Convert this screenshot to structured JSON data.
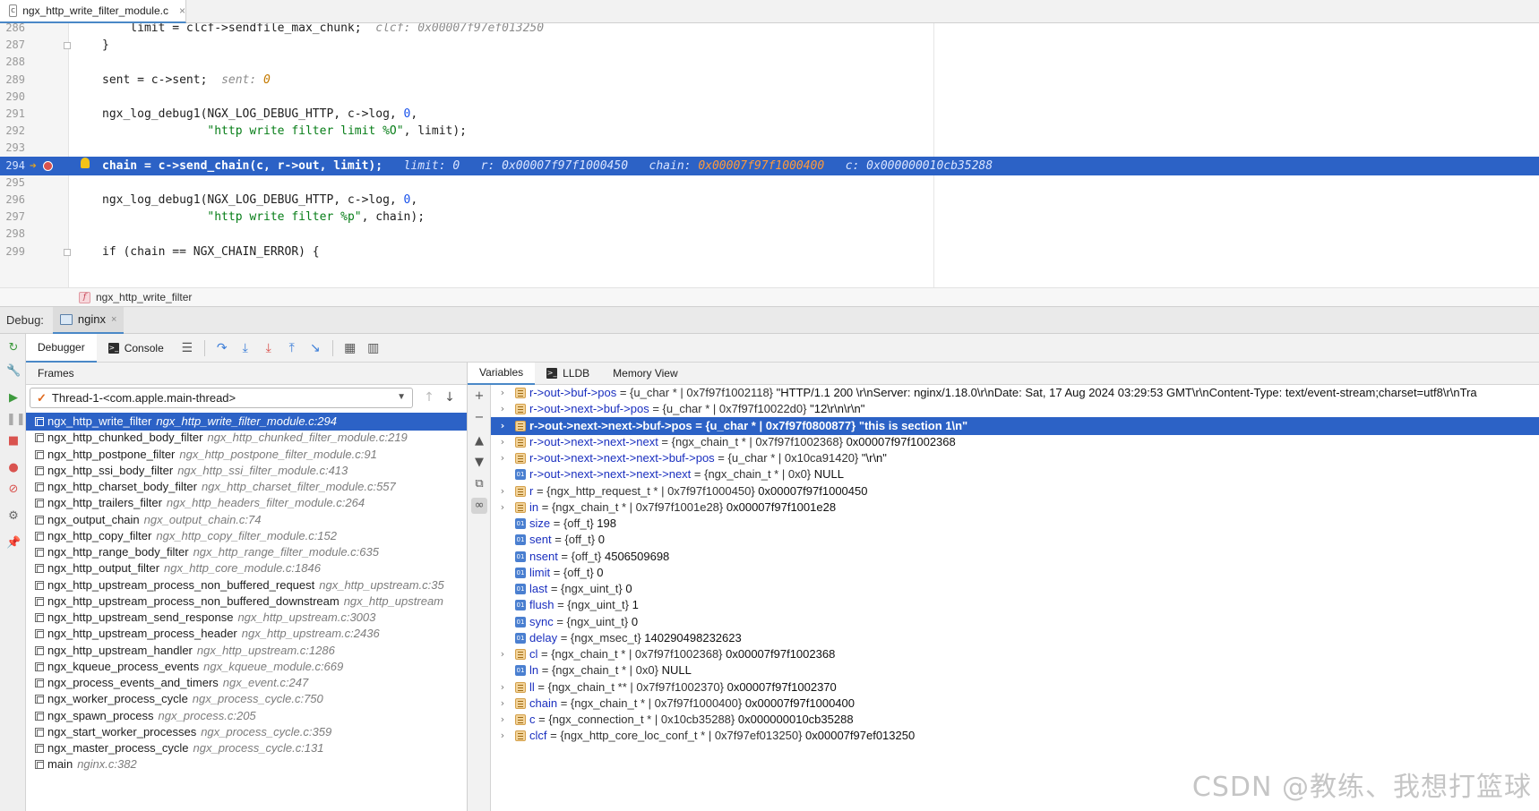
{
  "editor_tab": {
    "filename": "ngx_http_write_filter_module.c",
    "close": "×"
  },
  "code_lines": [
    {
      "n": "286",
      "code": "    limit = clcf->sendfile_max_chunk;",
      "hint": "clcf: 0x00007f97ef013250"
    },
    {
      "n": "287",
      "code": "}",
      "hint": ""
    },
    {
      "n": "288",
      "code": "",
      "hint": ""
    },
    {
      "n": "289",
      "code": "sent = c->sent;",
      "hint": "sent: ",
      "hint_num": "0"
    },
    {
      "n": "290",
      "code": "",
      "hint": ""
    },
    {
      "n": "291",
      "code_parts": [
        "ngx_log_debug1(NGX_LOG_DEBUG_HTTP, c->log, ",
        "0",
        ","
      ]
    },
    {
      "n": "292",
      "code_parts": [
        "               ",
        "\"http write filter limit %O\"",
        ", limit);"
      ]
    },
    {
      "n": "293",
      "code": "",
      "hint": ""
    },
    {
      "n": "294",
      "code": "chain = c->send_chain(c, r->out, limit);",
      "hints": [
        "limit: 0",
        "r: 0x00007f97f1000450",
        "chain: ",
        "0x00007f97f1000400",
        "c: 0x000000010cb35288"
      ]
    },
    {
      "n": "295",
      "code": "",
      "hint": ""
    },
    {
      "n": "296",
      "code_parts": [
        "ngx_log_debug1(NGX_LOG_DEBUG_HTTP, c->log, ",
        "0",
        ","
      ]
    },
    {
      "n": "297",
      "code_parts": [
        "               ",
        "\"http write filter %p\"",
        ", chain);"
      ]
    },
    {
      "n": "298",
      "code": "",
      "hint": ""
    },
    {
      "n": "299",
      "code": "if (chain == NGX_CHAIN_ERROR) {",
      "hint": ""
    }
  ],
  "breadcrumb": {
    "badge": "f",
    "function": "ngx_http_write_filter"
  },
  "debug": {
    "label": "Debug:",
    "session": "nginx",
    "session_close": "×",
    "tabs": {
      "debugger": "Debugger",
      "console": "Console"
    },
    "frames_title": "Frames",
    "thread": "Thread-1-<com.apple.main-thread>",
    "var_tabs": {
      "variables": "Variables",
      "lldb": "LLDB",
      "memory": "Memory View"
    }
  },
  "frames": [
    {
      "fn": "ngx_http_write_filter",
      "loc": "ngx_http_write_filter_module.c:294"
    },
    {
      "fn": "ngx_http_chunked_body_filter",
      "loc": "ngx_http_chunked_filter_module.c:219"
    },
    {
      "fn": "ngx_http_postpone_filter",
      "loc": "ngx_http_postpone_filter_module.c:91"
    },
    {
      "fn": "ngx_http_ssi_body_filter",
      "loc": "ngx_http_ssi_filter_module.c:413"
    },
    {
      "fn": "ngx_http_charset_body_filter",
      "loc": "ngx_http_charset_filter_module.c:557"
    },
    {
      "fn": "ngx_http_trailers_filter",
      "loc": "ngx_http_headers_filter_module.c:264"
    },
    {
      "fn": "ngx_output_chain",
      "loc": "ngx_output_chain.c:74"
    },
    {
      "fn": "ngx_http_copy_filter",
      "loc": "ngx_http_copy_filter_module.c:152"
    },
    {
      "fn": "ngx_http_range_body_filter",
      "loc": "ngx_http_range_filter_module.c:635"
    },
    {
      "fn": "ngx_http_output_filter",
      "loc": "ngx_http_core_module.c:1846"
    },
    {
      "fn": "ngx_http_upstream_process_non_buffered_request",
      "loc": "ngx_http_upstream.c:35"
    },
    {
      "fn": "ngx_http_upstream_process_non_buffered_downstream",
      "loc": "ngx_http_upstream"
    },
    {
      "fn": "ngx_http_upstream_send_response",
      "loc": "ngx_http_upstream.c:3003"
    },
    {
      "fn": "ngx_http_upstream_process_header",
      "loc": "ngx_http_upstream.c:2436"
    },
    {
      "fn": "ngx_http_upstream_handler",
      "loc": "ngx_http_upstream.c:1286"
    },
    {
      "fn": "ngx_kqueue_process_events",
      "loc": "ngx_kqueue_module.c:669"
    },
    {
      "fn": "ngx_process_events_and_timers",
      "loc": "ngx_event.c:247"
    },
    {
      "fn": "ngx_worker_process_cycle",
      "loc": "ngx_process_cycle.c:750"
    },
    {
      "fn": "ngx_spawn_process",
      "loc": "ngx_process.c:205"
    },
    {
      "fn": "ngx_start_worker_processes",
      "loc": "ngx_process_cycle.c:359"
    },
    {
      "fn": "ngx_master_process_cycle",
      "loc": "ngx_process_cycle.c:131"
    },
    {
      "fn": "main",
      "loc": "nginx.c:382"
    }
  ],
  "variables": [
    {
      "name": "r->out->buf->pos",
      "type": " = {u_char * | 0x7f97f1002118} ",
      "value": "\"HTTP/1.1 200 \\r\\nServer: nginx/1.18.0\\r\\nDate: Sat, 17 Aug 2024 03:29:53 GMT\\r\\nContent-Type: text/event-stream;charset=utf8\\r\\nTra",
      "expandable": true,
      "kind": "struct"
    },
    {
      "name": "r->out->next->buf->pos",
      "type": " = {u_char * | 0x7f97f10022d0} ",
      "value": "\"12\\r\\n\\r\\n\"",
      "expandable": true,
      "kind": "struct"
    },
    {
      "name": "r->out->next->next->buf->pos",
      "type": " = {u_char * | 0x7f97f0800877} ",
      "value": "\"this is section 1\\n\"",
      "expandable": true,
      "kind": "struct"
    },
    {
      "name": "r->out->next->next->next",
      "type": " = {ngx_chain_t * | 0x7f97f1002368} ",
      "value": "0x00007f97f1002368",
      "expandable": true,
      "kind": "struct"
    },
    {
      "name": "r->out->next->next->next->buf->pos",
      "type": " = {u_char * | 0x10ca91420} ",
      "value": "\"\\r\\n\"",
      "expandable": true,
      "kind": "struct"
    },
    {
      "name": "r->out->next->next->next->next",
      "type": " = {ngx_chain_t * | 0x0} ",
      "value": "NULL",
      "expandable": false,
      "kind": "prim"
    },
    {
      "name": "r",
      "type": " = {ngx_http_request_t * | 0x7f97f1000450} ",
      "value": "0x00007f97f1000450",
      "expandable": true,
      "kind": "struct"
    },
    {
      "name": "in",
      "type": " = {ngx_chain_t * | 0x7f97f1001e28} ",
      "value": "0x00007f97f1001e28",
      "expandable": true,
      "kind": "struct"
    },
    {
      "name": "size",
      "type": " = {off_t} ",
      "value": "198",
      "expandable": false,
      "kind": "prim"
    },
    {
      "name": "sent",
      "type": " = {off_t} ",
      "value": "0",
      "expandable": false,
      "kind": "prim"
    },
    {
      "name": "nsent",
      "type": " = {off_t} ",
      "value": "4506509698",
      "expandable": false,
      "kind": "prim"
    },
    {
      "name": "limit",
      "type": " = {off_t} ",
      "value": "0",
      "expandable": false,
      "kind": "prim"
    },
    {
      "name": "last",
      "type": " = {ngx_uint_t} ",
      "value": "0",
      "expandable": false,
      "kind": "prim"
    },
    {
      "name": "flush",
      "type": " = {ngx_uint_t} ",
      "value": "1",
      "expandable": false,
      "kind": "prim"
    },
    {
      "name": "sync",
      "type": " = {ngx_uint_t} ",
      "value": "0",
      "expandable": false,
      "kind": "prim"
    },
    {
      "name": "delay",
      "type": " = {ngx_msec_t} ",
      "value": "140290498232623",
      "expandable": false,
      "kind": "prim"
    },
    {
      "name": "cl",
      "type": " = {ngx_chain_t * | 0x7f97f1002368} ",
      "value": "0x00007f97f1002368",
      "expandable": true,
      "kind": "struct"
    },
    {
      "name": "ln",
      "type": " = {ngx_chain_t * | 0x0} ",
      "value": "NULL",
      "expandable": false,
      "kind": "prim"
    },
    {
      "name": "ll",
      "type": " = {ngx_chain_t ** | 0x7f97f1002370} ",
      "value": "0x00007f97f1002370",
      "expandable": true,
      "kind": "struct"
    },
    {
      "name": "chain",
      "type": " = {ngx_chain_t * | 0x7f97f1000400} ",
      "value": "0x00007f97f1000400",
      "expandable": true,
      "kind": "struct"
    },
    {
      "name": "c",
      "type": " = {ngx_connection_t * | 0x10cb35288} ",
      "value": "0x000000010cb35288",
      "expandable": true,
      "kind": "struct"
    },
    {
      "name": "clcf",
      "type": " = {ngx_http_core_loc_conf_t * | 0x7f97ef013250} ",
      "value": "0x00007f97ef013250",
      "expandable": true,
      "kind": "struct"
    }
  ],
  "prim_icon_label": "01",
  "watermark": "CSDN @教练、我想打篮球"
}
